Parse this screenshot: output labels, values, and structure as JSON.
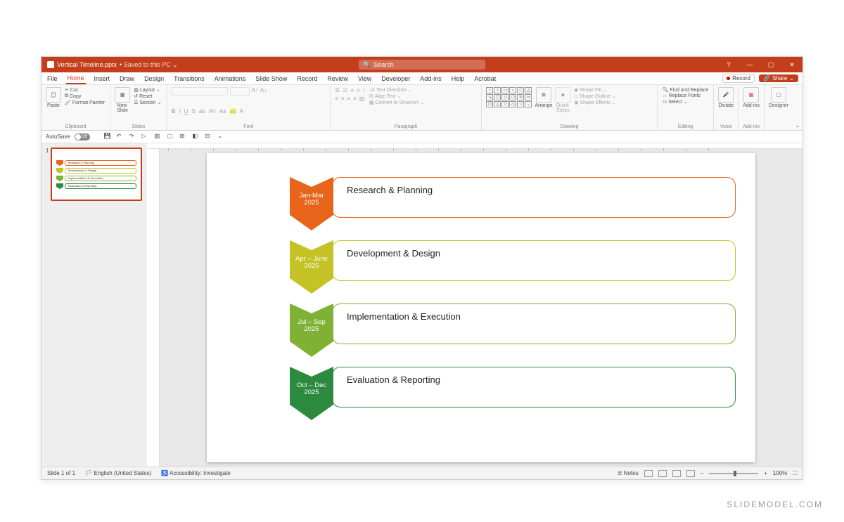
{
  "titlebar": {
    "filename": "Vertical Timeline.pptx",
    "saved": "Saved to this PC",
    "search_placeholder": "Search"
  },
  "menu": {
    "file": "File",
    "home": "Home",
    "insert": "Insert",
    "draw": "Draw",
    "design": "Design",
    "transitions": "Transitions",
    "animations": "Animations",
    "slideshow": "Slide Show",
    "record": "Record",
    "review": "Review",
    "view": "View",
    "developer": "Developer",
    "addins": "Add-ins",
    "help": "Help",
    "acrobat": "Acrobat",
    "record_btn": "Record",
    "share": "Share"
  },
  "ribbon": {
    "clipboard": {
      "paste": "Paste",
      "cut": "Cut",
      "copy": "Copy",
      "format_painter": "Format Painter",
      "label": "Clipboard"
    },
    "slides": {
      "new_slide": "New\nSlide",
      "layout": "Layout",
      "reset": "Reset",
      "section": "Section",
      "label": "Slides"
    },
    "font": {
      "label": "Font"
    },
    "paragraph": {
      "text_direction": "Text Direction",
      "align_text": "Align Text",
      "smartart": "Convert to SmartArt",
      "label": "Paragraph"
    },
    "drawing": {
      "arrange": "Arrange",
      "quick_styles": "Quick\nStyles",
      "shape_fill": "Shape Fill",
      "shape_outline": "Shape Outline",
      "shape_effects": "Shape Effects",
      "label": "Drawing"
    },
    "editing": {
      "find": "Find and Replace",
      "replace": "Replace Fonts",
      "select": "Select",
      "label": "Editing"
    },
    "voice": {
      "dictate": "Dictate",
      "label": "Voice"
    },
    "addins": {
      "addins": "Add-ins",
      "label": "Add-ins"
    },
    "designer": {
      "designer": "Designer"
    }
  },
  "qat": {
    "autosave": "AutoSave",
    "off": "Off"
  },
  "timeline": [
    {
      "period_l1": "Jan-Mar",
      "period_l2": "2025",
      "title": "Research & Planning",
      "color": "#e8641b"
    },
    {
      "period_l1": "Apr – June",
      "period_l2": "2025",
      "title": "Development & Design",
      "color": "#c4c224"
    },
    {
      "period_l1": "Jul – Sep",
      "period_l2": "2025",
      "title": "Implementation & Execution",
      "color": "#7fb135"
    },
    {
      "period_l1": "Oct – Dec",
      "period_l2": "2025",
      "title": "Evaluation & Reporting",
      "color": "#2b8a3e"
    }
  ],
  "status": {
    "slide": "Slide 1 of 1",
    "lang": "English (United States)",
    "a11y": "Accessibility: Investigate",
    "notes": "Notes",
    "zoom": "100%"
  },
  "watermark": "SLIDEMODEL.COM",
  "thumb_num": "1"
}
